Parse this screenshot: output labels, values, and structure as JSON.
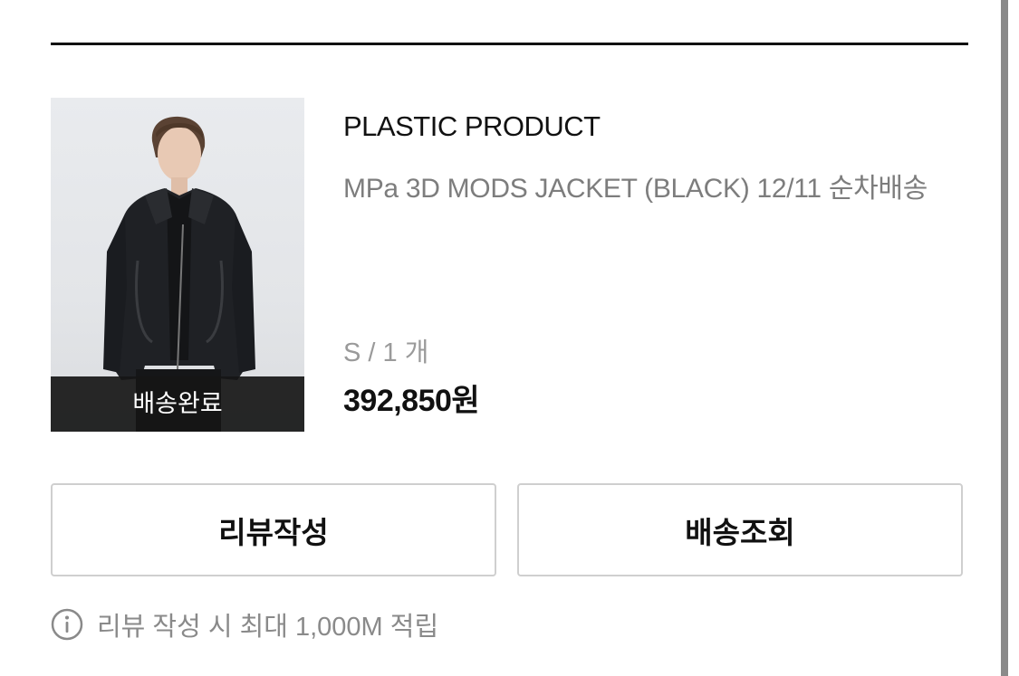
{
  "product": {
    "brand": "PLASTIC PRODUCT",
    "name": "MPa 3D MODS JACKET (BLACK) 12/11 순차배송",
    "option": "S / 1 개",
    "price": "392,850원",
    "status_label": "배송완료"
  },
  "actions": {
    "review_label": "리뷰작성",
    "track_label": "배송조회"
  },
  "notice": {
    "icon": "info-icon",
    "text": "리뷰 작성 시 최대 1,000M 적립"
  }
}
